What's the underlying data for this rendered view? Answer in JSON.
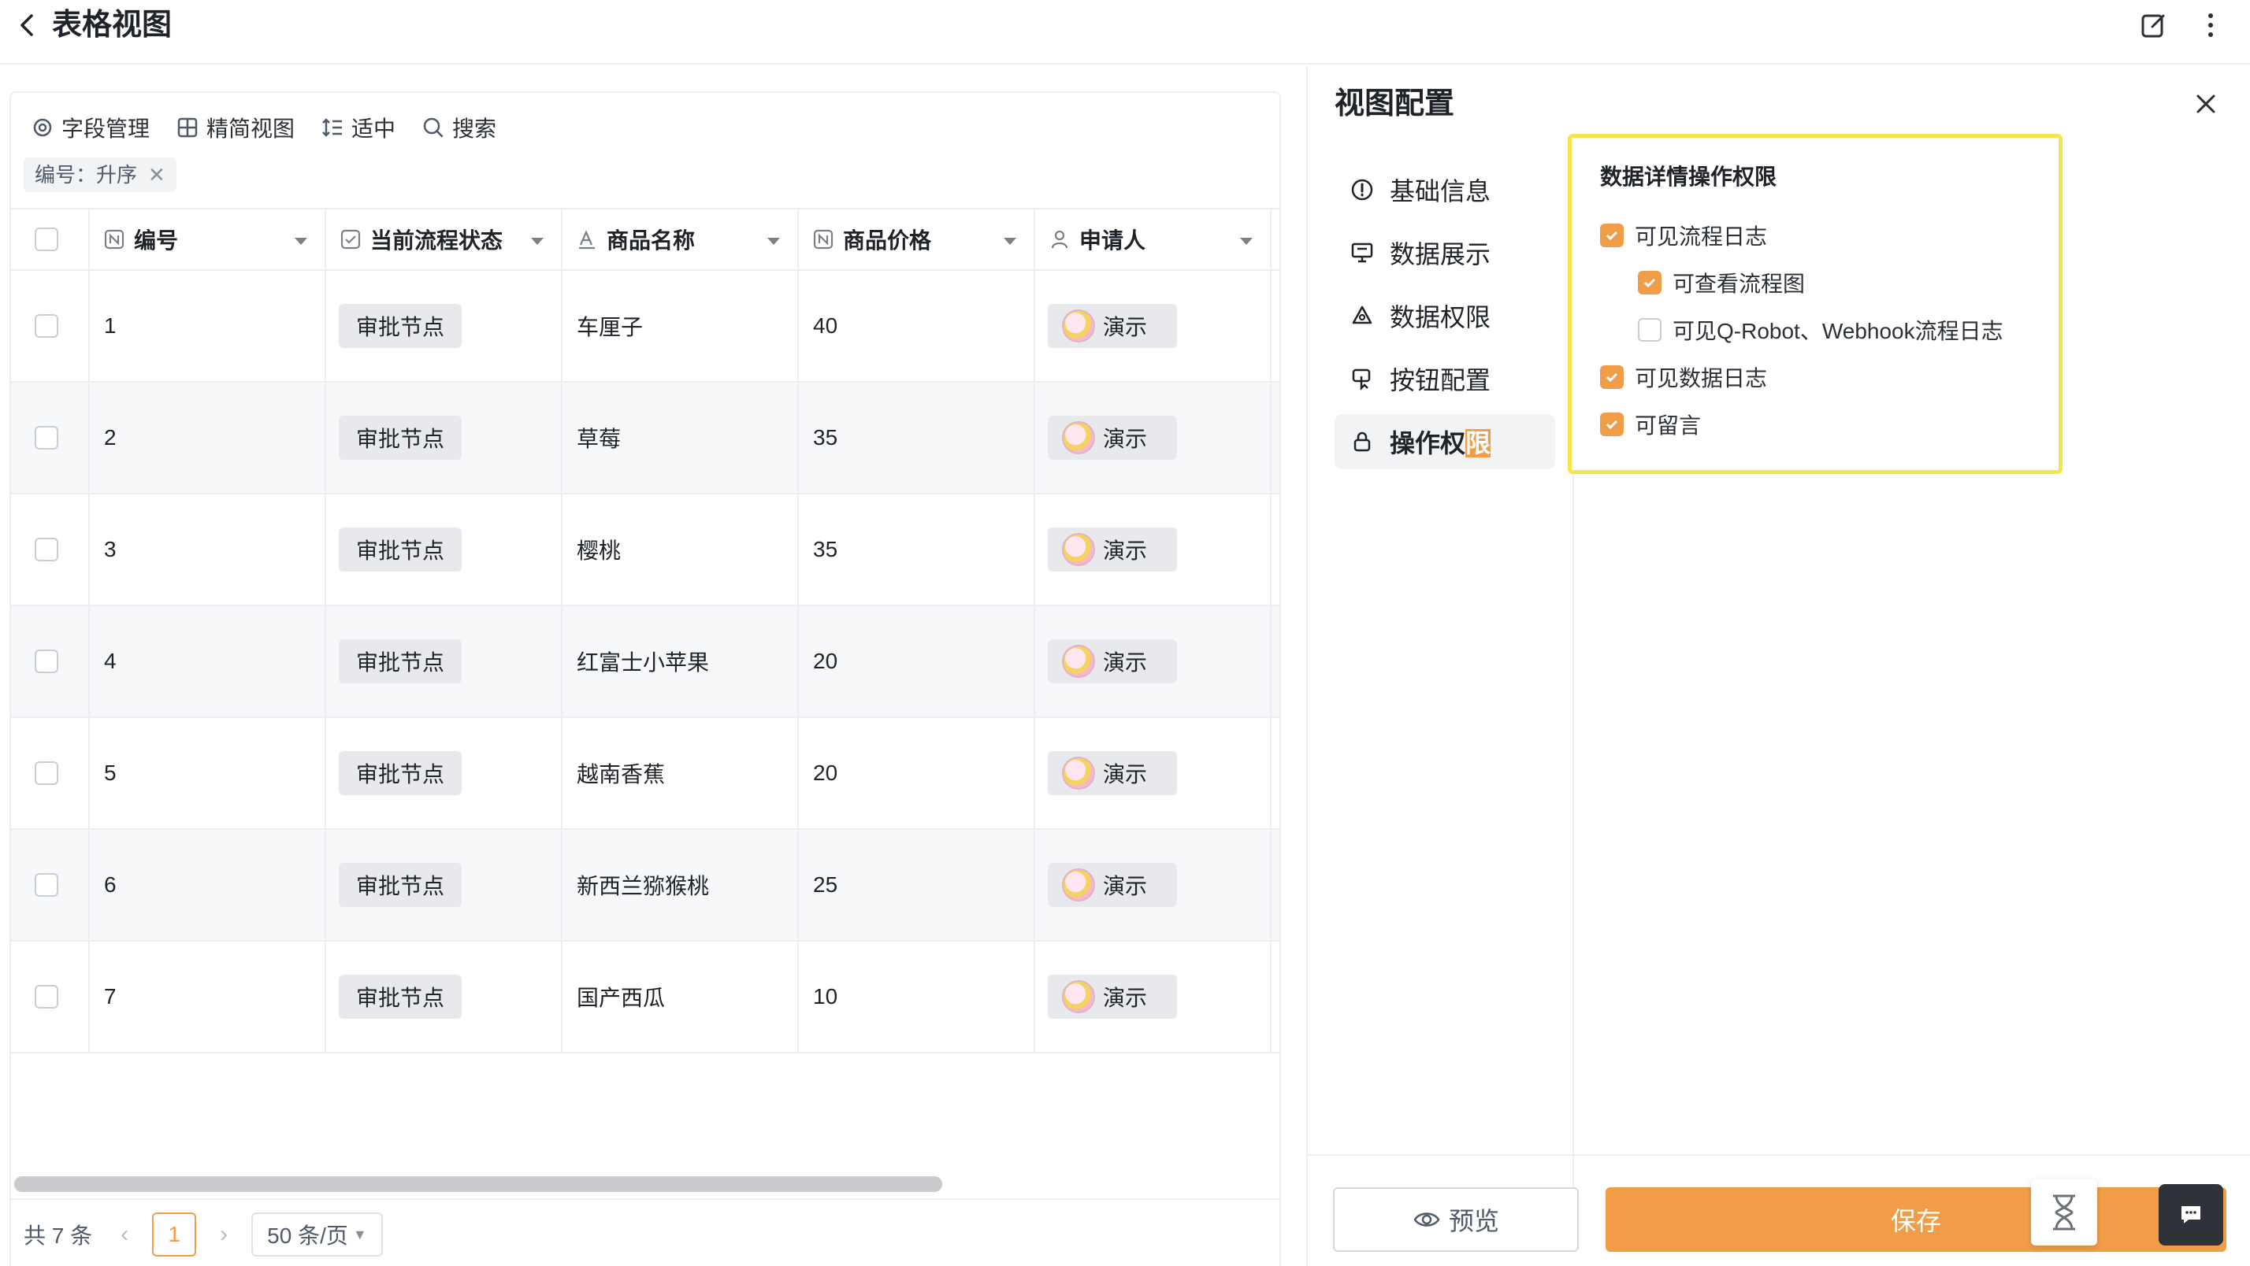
{
  "header": {
    "title": "表格视图"
  },
  "toolbar": {
    "field_manage": "字段管理",
    "compact_view": "精简视图",
    "density": "适中",
    "search": "搜索"
  },
  "sort_tag": {
    "label": "编号：升序"
  },
  "columns": [
    {
      "label": "编号"
    },
    {
      "label": "当前流程状态"
    },
    {
      "label": "商品名称"
    },
    {
      "label": "商品价格"
    },
    {
      "label": "申请人"
    }
  ],
  "rows": [
    {
      "id": "1",
      "status": "审批节点",
      "name": "车厘子",
      "price": "40",
      "applicant": "演示"
    },
    {
      "id": "2",
      "status": "审批节点",
      "name": "草莓",
      "price": "35",
      "applicant": "演示"
    },
    {
      "id": "3",
      "status": "审批节点",
      "name": "樱桃",
      "price": "35",
      "applicant": "演示"
    },
    {
      "id": "4",
      "status": "审批节点",
      "name": "红富士小苹果",
      "price": "20",
      "applicant": "演示"
    },
    {
      "id": "5",
      "status": "审批节点",
      "name": "越南香蕉",
      "price": "20",
      "applicant": "演示"
    },
    {
      "id": "6",
      "status": "审批节点",
      "name": "新西兰猕猴桃",
      "price": "25",
      "applicant": "演示"
    },
    {
      "id": "7",
      "status": "审批节点",
      "name": "国产西瓜",
      "price": "10",
      "applicant": "演示"
    }
  ],
  "pagination": {
    "total": "共 7 条",
    "current": "1",
    "page_size": "50 条/页"
  },
  "config": {
    "title": "视图配置",
    "menu": [
      {
        "label": "基础信息"
      },
      {
        "label": "数据展示"
      },
      {
        "label": "数据权限"
      },
      {
        "label": "按钮配置"
      },
      {
        "label_main": "操作权",
        "label_hl": "限"
      }
    ],
    "permissions": {
      "title": "数据详情操作权限",
      "items": [
        {
          "label": "可见流程日志",
          "checked": true
        },
        {
          "label": "可查看流程图",
          "checked": true
        },
        {
          "label": "可见Q-Robot、Webhook流程日志",
          "checked": false
        },
        {
          "label": "可见数据日志",
          "checked": true
        },
        {
          "label": "可留言",
          "checked": true
        }
      ]
    },
    "preview_label": "预览",
    "save_label": "保存"
  },
  "colors": {
    "accent": "#f19d47",
    "highlight_border": "#f7e34a"
  }
}
